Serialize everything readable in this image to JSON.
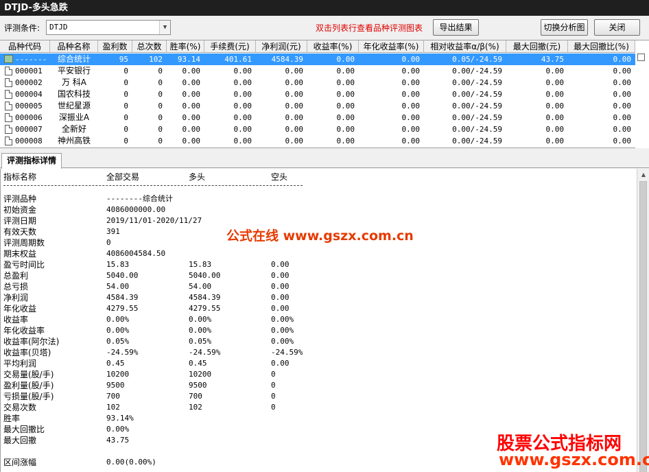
{
  "window": {
    "title": "DTJD-多头急跌"
  },
  "toolbar": {
    "condition_label": "评测条件:",
    "condition_value": "DTJD",
    "hint": "双击列表行查看品种评测图表",
    "export_label": "导出结果",
    "switch_label": "切换分析图",
    "close_label": "关闭"
  },
  "grid": {
    "columns": [
      "品种代码",
      "品种名称",
      "盈利数",
      "总次数",
      "胜率(%)",
      "手续费(元)",
      "净利润(元)",
      "收益率(%)",
      "年化收益率(%)",
      "相对收益率α/β(%)",
      "最大回撤(元)",
      "最大回撤比(%)"
    ],
    "rows": [
      [
        "-------",
        "综合统计",
        "95",
        "102",
        "93.14",
        "401.61",
        "4584.39",
        "0.00",
        "0.00",
        "0.05/-24.59",
        "43.75",
        "0.00"
      ],
      [
        "000001",
        "平安银行",
        "0",
        "0",
        "0.00",
        "0.00",
        "0.00",
        "0.00",
        "0.00",
        "0.00/-24.59",
        "0.00",
        "0.00"
      ],
      [
        "000002",
        "万 科A",
        "0",
        "0",
        "0.00",
        "0.00",
        "0.00",
        "0.00",
        "0.00",
        "0.00/-24.59",
        "0.00",
        "0.00"
      ],
      [
        "000004",
        "国农科技",
        "0",
        "0",
        "0.00",
        "0.00",
        "0.00",
        "0.00",
        "0.00",
        "0.00/-24.59",
        "0.00",
        "0.00"
      ],
      [
        "000005",
        "世纪星源",
        "0",
        "0",
        "0.00",
        "0.00",
        "0.00",
        "0.00",
        "0.00",
        "0.00/-24.59",
        "0.00",
        "0.00"
      ],
      [
        "000006",
        "深振业A",
        "0",
        "0",
        "0.00",
        "0.00",
        "0.00",
        "0.00",
        "0.00",
        "0.00/-24.59",
        "0.00",
        "0.00"
      ],
      [
        "000007",
        "全新好",
        "0",
        "0",
        "0.00",
        "0.00",
        "0.00",
        "0.00",
        "0.00",
        "0.00/-24.59",
        "0.00",
        "0.00"
      ],
      [
        "000008",
        "神州高铁",
        "0",
        "0",
        "0.00",
        "0.00",
        "0.00",
        "0.00",
        "0.00",
        "0.00/-24.59",
        "0.00",
        "0.00"
      ]
    ]
  },
  "detail_tab": {
    "label": "评测指标详情"
  },
  "detail": {
    "headers": [
      "指标名称",
      "全部交易",
      "多头",
      "空头"
    ],
    "separator": "--------------------------------------------------------------------------------------",
    "rows": [
      [
        "评测品种",
        "--------综合统计",
        "",
        ""
      ],
      [
        "初始资金",
        "4086000000.00",
        "",
        ""
      ],
      [
        "评测日期",
        "2019/11/01-2020/11/27",
        "",
        ""
      ],
      [
        "有效天数",
        "391",
        "",
        ""
      ],
      [
        "评测周期数",
        "0",
        "",
        ""
      ],
      [
        "期末权益",
        "4086004584.50",
        "",
        ""
      ],
      [
        "盈亏时间比",
        "15.83",
        "15.83",
        "0.00"
      ],
      [
        "总盈利",
        "5040.00",
        "5040.00",
        "0.00"
      ],
      [
        "总亏损",
        "54.00",
        "54.00",
        "0.00"
      ],
      [
        "净利润",
        "4584.39",
        "4584.39",
        "0.00"
      ],
      [
        "年化收益",
        "4279.55",
        "4279.55",
        "0.00"
      ],
      [
        "收益率",
        "0.00%",
        "0.00%",
        "0.00%"
      ],
      [
        "年化收益率",
        "0.00%",
        "0.00%",
        "0.00%"
      ],
      [
        "收益率(阿尔法)",
        "0.05%",
        "0.05%",
        "0.00%"
      ],
      [
        "收益率(贝塔)",
        "-24.59%",
        "-24.59%",
        "-24.59%"
      ],
      [
        "平均利润",
        "0.45",
        "0.45",
        "0.00"
      ],
      [
        "交易量(股/手)",
        "10200",
        "10200",
        "0"
      ],
      [
        "盈利量(股/手)",
        "9500",
        "9500",
        "0"
      ],
      [
        "亏损量(股/手)",
        "700",
        "700",
        "0"
      ],
      [
        "交易次数",
        "102",
        "102",
        "0"
      ],
      [
        "胜率",
        "93.14%",
        "",
        ""
      ],
      [
        "最大回撤比",
        "0.00%",
        "",
        ""
      ],
      [
        "最大回撤",
        "43.75",
        "",
        ""
      ],
      [
        "",
        "",
        "",
        ""
      ],
      [
        "区间涨幅",
        "0.00(0.00%)",
        "",
        ""
      ]
    ]
  },
  "watermarks": {
    "center": "公式在线 www.gszx.com.cn",
    "corner_title": "股票公式指标网",
    "corner_url": "www.gszx.com.cn"
  }
}
